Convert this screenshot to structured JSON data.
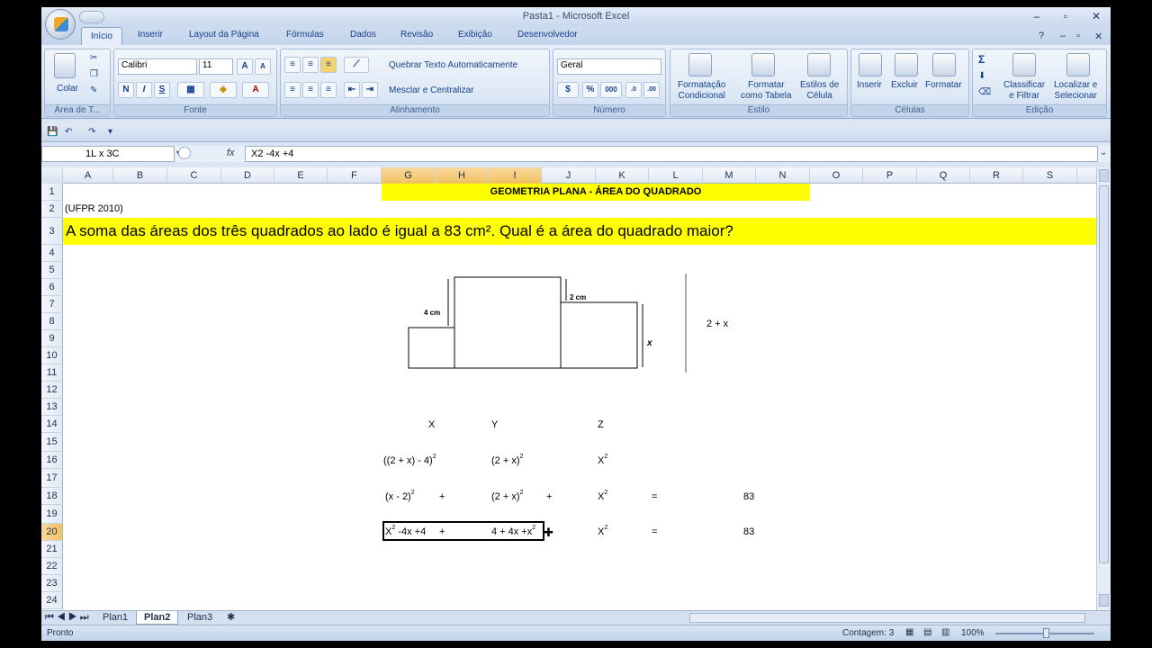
{
  "window": {
    "title": "Pasta1 - Microsoft Excel"
  },
  "tabs": [
    "Início",
    "Inserir",
    "Layout da Página",
    "Fórmulas",
    "Dados",
    "Revisão",
    "Exibição",
    "Desenvolvedor"
  ],
  "ribbon": {
    "clipboard": {
      "paste": "Colar",
      "label": "Área de T..."
    },
    "font": {
      "name": "Calibri",
      "size": "11",
      "bold": "N",
      "italic": "I",
      "underline": "S",
      "label": "Fonte"
    },
    "alignment": {
      "wrap": "Quebrar Texto Automaticamente",
      "merge": "Mesclar e Centralizar",
      "label": "Alinhamento"
    },
    "number": {
      "format": "Geral",
      "label": "Número"
    },
    "styles": {
      "cond": "Formatação\nCondicional",
      "table": "Formatar\ncomo Tabela",
      "cell": "Estilos de\nCélula",
      "label": "Estilo"
    },
    "cells": {
      "insert": "Inserir",
      "delete": "Excluir",
      "format": "Formatar",
      "label": "Células"
    },
    "editing": {
      "sort": "Classificar\ne Filtrar",
      "find": "Localizar e\nSelecionar",
      "label": "Edição"
    }
  },
  "formula_bar": {
    "name_box": "1L x 3C",
    "fx": "fx",
    "content": "X2 -4x +4"
  },
  "columns": [
    "A",
    "B",
    "C",
    "D",
    "E",
    "F",
    "G",
    "H",
    "I",
    "J",
    "K",
    "L",
    "M",
    "N",
    "O",
    "P",
    "Q",
    "R",
    "S"
  ],
  "rows": [
    "1",
    "2",
    "3",
    "4",
    "5",
    "6",
    "7",
    "8",
    "9",
    "10",
    "11",
    "12",
    "13",
    "14",
    "15",
    "16",
    "17",
    "18",
    "19",
    "20",
    "21",
    "22",
    "23",
    "24"
  ],
  "cells": {
    "title": "GEOMETRIA PLANA - ÁREA DO QUADRADO",
    "source": "(UFPR 2010)",
    "question": "A soma das áreas dos três quadrados ao lado é igual a 83 cm². Qual é a área do quadrado maior?",
    "fig_4cm": "4 cm",
    "fig_2cm": "2 cm",
    "fig_x": "x",
    "expr_2x": "2 + x",
    "hdr_x": "X",
    "hdr_y": "Y",
    "hdr_z": "Z",
    "r16_a": "((2 + x) - 4)",
    "r16_b": "(2 + x)",
    "r16_c": "X",
    "r18_a": "(x - 2)",
    "r18_b": "(2 + x)",
    "r18_c": "X",
    "plus": "+",
    "eq": "=",
    "val83": "83",
    "r20_a1": "X",
    "r20_a2": " -4x +4",
    "r20_b": "4 + 4x +x",
    "r20_c": "X",
    "sup2": "2"
  },
  "sheets": [
    "Plan1",
    "Plan2",
    "Plan3"
  ],
  "status": {
    "left": "Pronto",
    "count": "Contagem: 3",
    "zoom": "100%"
  }
}
